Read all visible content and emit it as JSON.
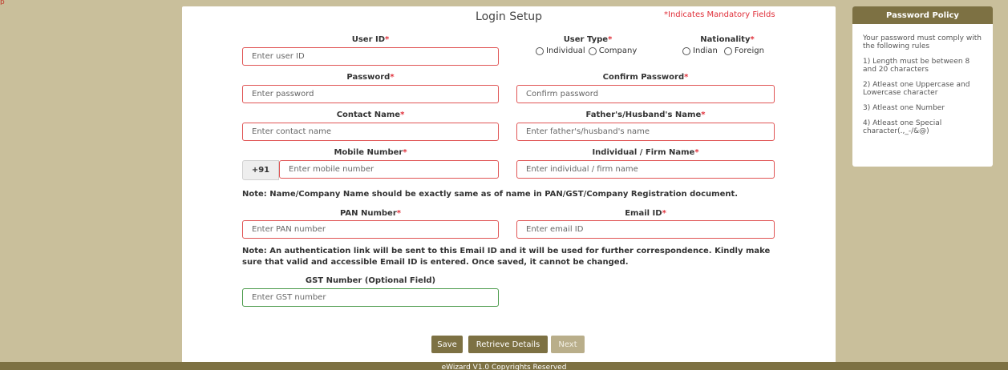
{
  "top_mark": "p",
  "form": {
    "title": "Login Setup",
    "mandatory_note": "*Indicates Mandatory Fields",
    "user_id": {
      "label": "User ID",
      "placeholder": "Enter user ID"
    },
    "user_type": {
      "label": "User Type",
      "options": [
        "Individual",
        "Company"
      ]
    },
    "nationality": {
      "label": "Nationality",
      "options": [
        "Indian",
        "Foreign"
      ]
    },
    "password": {
      "label": "Password",
      "placeholder": "Enter password"
    },
    "confirm_password": {
      "label": "Confirm Password",
      "placeholder": "Confirm password"
    },
    "contact_name": {
      "label": "Contact Name",
      "placeholder": "Enter contact name"
    },
    "father_name": {
      "label": "Father's/Husband's Name",
      "placeholder": "Enter father's/husband's name"
    },
    "mobile": {
      "label": "Mobile Number",
      "prefix": "+91",
      "placeholder": "Enter mobile number"
    },
    "firm_name": {
      "label": "Individual / Firm Name",
      "placeholder": "Enter individual / firm name"
    },
    "name_note": "Note: Name/Company Name should be exactly same as of name in PAN/GST/Company Registration document.",
    "pan": {
      "label": "PAN Number",
      "placeholder": "Enter PAN number"
    },
    "email": {
      "label": "Email ID",
      "placeholder": "Enter email ID"
    },
    "email_note_line1": "Note: An authentication link will be sent to this Email ID and it will be used for further correspondence. Kindly make",
    "email_note_line2": "sure that valid and accessible Email ID is entered. Once saved, it cannot be changed.",
    "gst": {
      "label": "GST Number (Optional Field)",
      "placeholder": "Enter GST number"
    },
    "required_mark": "*"
  },
  "buttons": {
    "save": "Save",
    "retrieve": "Retrieve Details",
    "next": "Next"
  },
  "footer": "eWizard V1.0 Copyrights Reserved",
  "policy": {
    "title": "Password Policy",
    "intro": "Your password must comply with the following rules",
    "rules": [
      "1) Length must be between 8 and 20 characters",
      "2) Atleast one Uppercase and Lowercase character",
      "3) Atleast one Number",
      "4) Atleast one Special character(.,_-/&@)"
    ]
  },
  "colors": {
    "background": "#c9bf9b",
    "brand": "#7d7143",
    "required": "#e0303a",
    "input_border": "#e05555",
    "optional_border": "#4a9a4a"
  }
}
